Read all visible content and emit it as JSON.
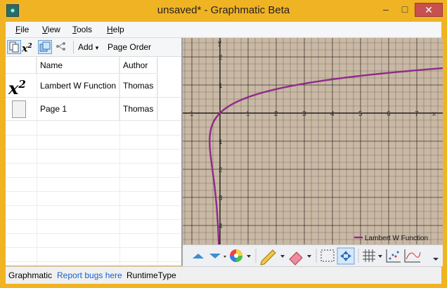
{
  "window": {
    "title": "unsaved* - Graphmatic Beta",
    "minimize": "–",
    "maximize": "□",
    "close": "✕"
  },
  "menu": {
    "items": [
      {
        "label": "File",
        "u": "F",
        "rest": "ile"
      },
      {
        "label": "View",
        "u": "V",
        "rest": "iew"
      },
      {
        "label": "Tools",
        "u": "T",
        "rest": "ools"
      },
      {
        "label": "Help",
        "u": "H",
        "rest": "elp"
      }
    ]
  },
  "toolbar": {
    "add_label": "Add",
    "add_arrow": "▾",
    "page_order_label": "Page Order",
    "equation_icon_text": "x",
    "equation_icon_sup": "2"
  },
  "table": {
    "headers": [
      "Name",
      "Author"
    ],
    "rows": [
      {
        "icon": "equation-icon",
        "name": "Lambert W Function",
        "author": "Thomas"
      },
      {
        "icon": "page-icon",
        "name": "Page 1",
        "author": "Thomas"
      }
    ],
    "equation_glyph": "x",
    "equation_sup": "2"
  },
  "graph": {
    "x_label": "x",
    "y_label": "y",
    "x_ticks": [
      "1",
      "1",
      "2",
      "3",
      "4",
      "5",
      "6",
      "7"
    ],
    "y_ticks": [
      "2",
      "1",
      "1",
      "2",
      "3",
      "4"
    ],
    "legend": "Lambert W Function",
    "curve_color": "#8e2a8c",
    "background": "#c9b8a4",
    "grid_color": "#000000"
  },
  "status": {
    "app": "Graphmatic",
    "report": "Report bugs here",
    "runtime": "RuntimeType"
  }
}
